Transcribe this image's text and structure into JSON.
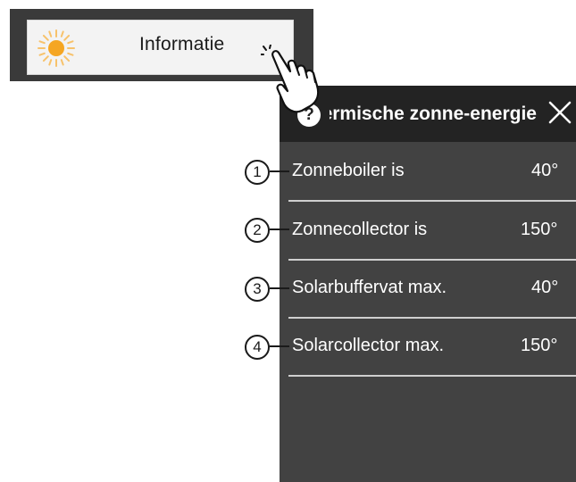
{
  "info_button": {
    "label": "Informatie",
    "icon": "sun-icon"
  },
  "panel": {
    "title": "Thermische zonne-energie",
    "help_icon_glyph": "?",
    "close_icon": "close-icon",
    "rows": [
      {
        "label": "Zonneboiler is",
        "value": "40°"
      },
      {
        "label": "Zonnecollector is",
        "value": "150°"
      },
      {
        "label": "Solarbuffervat max.",
        "value": "40°"
      },
      {
        "label": "Solarcollector max.",
        "value": "150°"
      }
    ]
  },
  "callouts": [
    "1",
    "2",
    "3",
    "4"
  ],
  "colors": {
    "panel_bg": "#424242",
    "header_bg": "#232323",
    "frame_bg": "#3a3a3a",
    "sun": "#f5a623"
  }
}
